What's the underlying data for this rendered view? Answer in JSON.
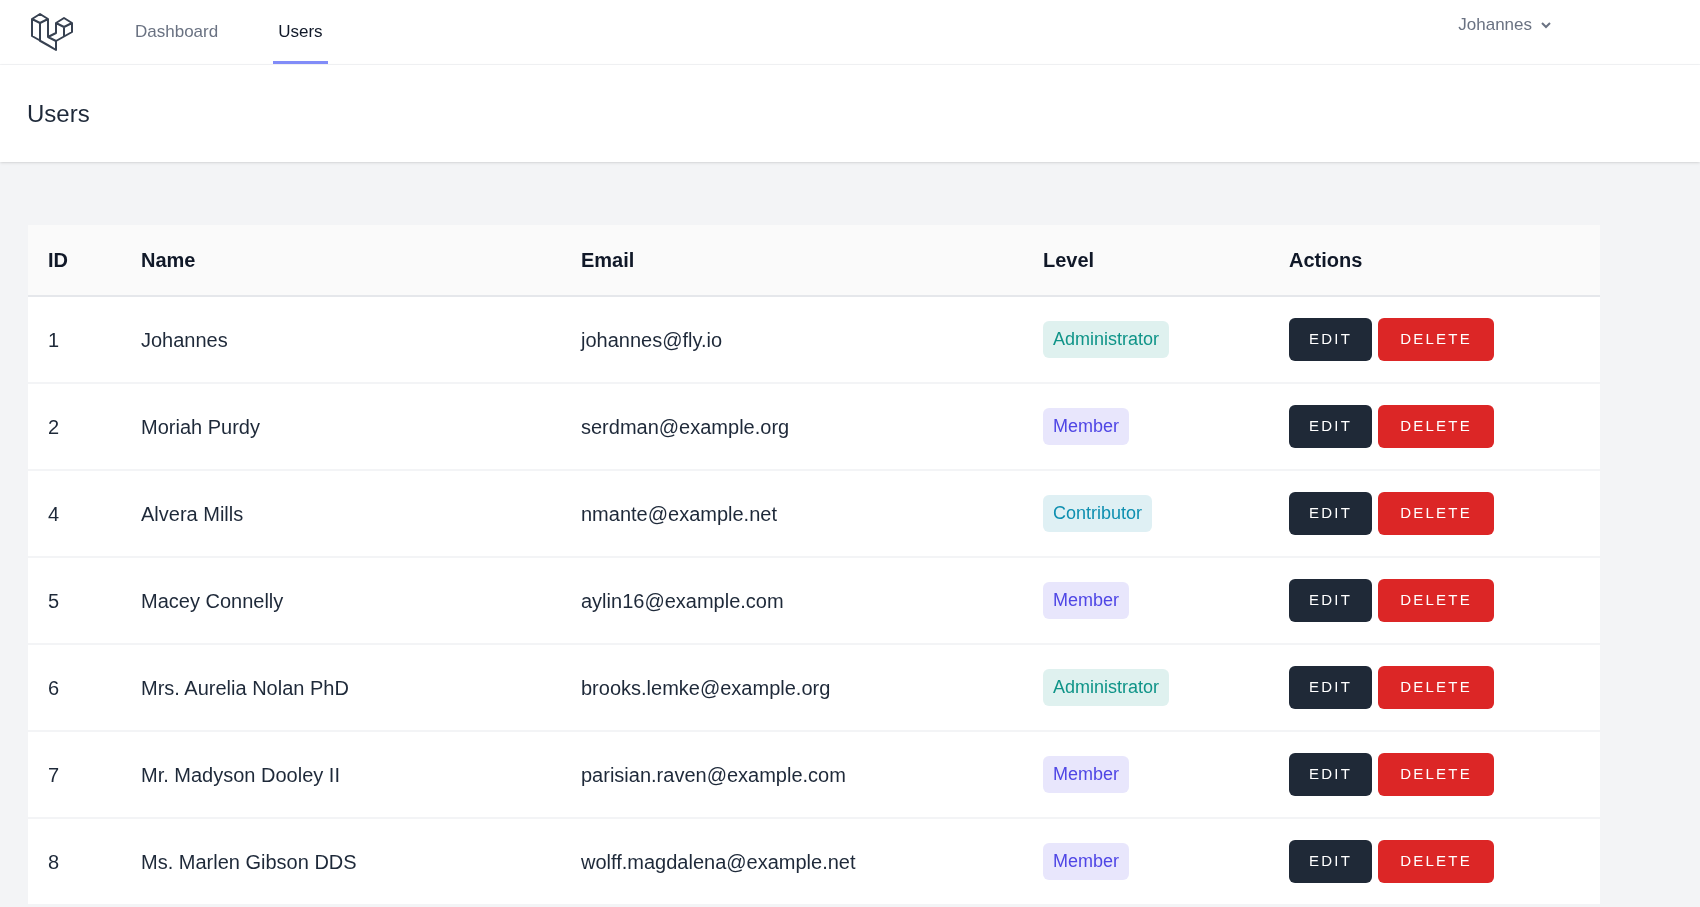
{
  "nav": {
    "tabs": [
      {
        "label": "Dashboard",
        "selected": false
      },
      {
        "label": "Users",
        "selected": true
      }
    ],
    "user_menu": "Johannes"
  },
  "header": {
    "title": "Users"
  },
  "table": {
    "columns": [
      "ID",
      "Name",
      "Email",
      "Level",
      "Actions"
    ],
    "rows": [
      {
        "id": "1",
        "name": "Johannes",
        "email": "johannes@fly.io",
        "level": "Administrator",
        "color": "#0f9488",
        "actions": [
          "EDIT",
          "DELETE"
        ]
      },
      {
        "id": "2",
        "name": "Moriah Purdy",
        "email": "serdman@example.org",
        "level": "Member",
        "color": "#4f46e5",
        "actions": [
          "EDIT",
          "DELETE"
        ]
      },
      {
        "id": "4",
        "name": "Alvera Mills",
        "email": "nmante@example.net",
        "level": "Contributor",
        "color": "#0e8fb0",
        "actions": [
          "EDIT",
          "DELETE"
        ]
      },
      {
        "id": "5",
        "name": "Macey Connelly",
        "email": "aylin16@example.com",
        "level": "Member",
        "color": "#4f46e5",
        "actions": [
          "EDIT",
          "DELETE"
        ]
      },
      {
        "id": "6",
        "name": "Mrs. Aurelia Nolan PhD",
        "email": "brooks.lemke@example.org",
        "level": "Administrator",
        "color": "#0f9488",
        "actions": [
          "EDIT",
          "DELETE"
        ]
      },
      {
        "id": "7",
        "name": "Mr. Madyson Dooley II",
        "email": "parisian.raven@example.com",
        "level": "Member",
        "color": "#4f46e5",
        "actions": [
          "EDIT",
          "DELETE"
        ]
      },
      {
        "id": "8",
        "name": "Ms. Marlen Gibson DDS",
        "email": "wolff.magdalena@example.net",
        "level": "Member",
        "color": "#4f46e5",
        "actions": [
          "EDIT",
          "DELETE"
        ]
      }
    ]
  }
}
